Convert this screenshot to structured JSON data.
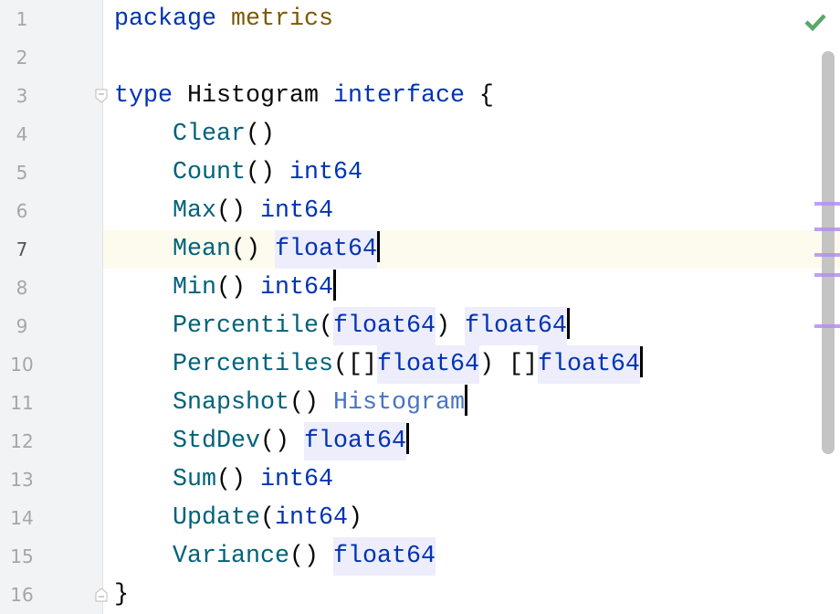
{
  "editor": {
    "current_line": 7,
    "status_icon": "check-icon",
    "colors": {
      "keyword": "#0033b3",
      "package": "#7a5a00",
      "method": "#00627a",
      "type_ref": "#4a74c4",
      "highlight": "#ededfc",
      "current_line": "#fdfbee",
      "marker": "#b38ff0",
      "check": "#59a869"
    },
    "fold_lines": [
      3,
      16
    ],
    "marker_lines": [
      6,
      7,
      8,
      9,
      11
    ],
    "lines": [
      {
        "n": "1",
        "tokens": [
          [
            "kw",
            "package"
          ],
          [
            "pl",
            " "
          ],
          [
            "pkg",
            "metrics"
          ]
        ]
      },
      {
        "n": "2",
        "tokens": []
      },
      {
        "n": "3",
        "tokens": [
          [
            "kw",
            "type"
          ],
          [
            "pl",
            " Histogram "
          ],
          [
            "kw",
            "interface"
          ],
          [
            "pl",
            " {"
          ]
        ]
      },
      {
        "n": "4",
        "tokens": [
          [
            "pl",
            "    "
          ],
          [
            "fn",
            "Clear"
          ],
          [
            "pl",
            "()"
          ]
        ]
      },
      {
        "n": "5",
        "tokens": [
          [
            "pl",
            "    "
          ],
          [
            "fn",
            "Count"
          ],
          [
            "pl",
            "() "
          ],
          [
            "kw",
            "int64"
          ]
        ]
      },
      {
        "n": "6",
        "tokens": [
          [
            "pl",
            "    "
          ],
          [
            "fn",
            "Max"
          ],
          [
            "pl",
            "() "
          ],
          [
            "kw",
            "int64"
          ]
        ]
      },
      {
        "n": "7",
        "tokens": [
          [
            "pl",
            "    "
          ],
          [
            "fn",
            "Mean"
          ],
          [
            "pl",
            "() "
          ],
          [
            "kw hl",
            "float64"
          ],
          [
            "caret",
            ""
          ]
        ]
      },
      {
        "n": "8",
        "tokens": [
          [
            "pl",
            "    "
          ],
          [
            "fn",
            "Min"
          ],
          [
            "pl",
            "() "
          ],
          [
            "kw",
            "int64"
          ],
          [
            "caret",
            ""
          ]
        ]
      },
      {
        "n": "9",
        "tokens": [
          [
            "pl",
            "    "
          ],
          [
            "fn",
            "Percentile"
          ],
          [
            "pl",
            "("
          ],
          [
            "kw hl",
            "float64"
          ],
          [
            "pl",
            ") "
          ],
          [
            "kw hl",
            "float64"
          ],
          [
            "caret",
            ""
          ]
        ]
      },
      {
        "n": "10",
        "tokens": [
          [
            "pl",
            "    "
          ],
          [
            "fn",
            "Percentiles"
          ],
          [
            "pl",
            "([]"
          ],
          [
            "kw hl",
            "float64"
          ],
          [
            "pl",
            ") []"
          ],
          [
            "kw hl",
            "float64"
          ],
          [
            "caret",
            ""
          ]
        ]
      },
      {
        "n": "11",
        "tokens": [
          [
            "pl",
            "    "
          ],
          [
            "fn",
            "Snapshot"
          ],
          [
            "pl",
            "() "
          ],
          [
            "ty",
            "Histogram"
          ],
          [
            "caret",
            ""
          ]
        ]
      },
      {
        "n": "12",
        "tokens": [
          [
            "pl",
            "    "
          ],
          [
            "fn",
            "StdDev"
          ],
          [
            "pl",
            "() "
          ],
          [
            "kw hl",
            "float64"
          ],
          [
            "caret",
            ""
          ]
        ]
      },
      {
        "n": "13",
        "tokens": [
          [
            "pl",
            "    "
          ],
          [
            "fn",
            "Sum"
          ],
          [
            "pl",
            "() "
          ],
          [
            "kw",
            "int64"
          ]
        ]
      },
      {
        "n": "14",
        "tokens": [
          [
            "pl",
            "    "
          ],
          [
            "fn",
            "Update"
          ],
          [
            "pl",
            "("
          ],
          [
            "kw",
            "int64"
          ],
          [
            "pl",
            ")"
          ]
        ]
      },
      {
        "n": "15",
        "tokens": [
          [
            "pl",
            "    "
          ],
          [
            "fn",
            "Variance"
          ],
          [
            "pl",
            "() "
          ],
          [
            "kw hl",
            "float64"
          ]
        ]
      },
      {
        "n": "16",
        "tokens": [
          [
            "pl",
            "}"
          ]
        ]
      }
    ]
  }
}
